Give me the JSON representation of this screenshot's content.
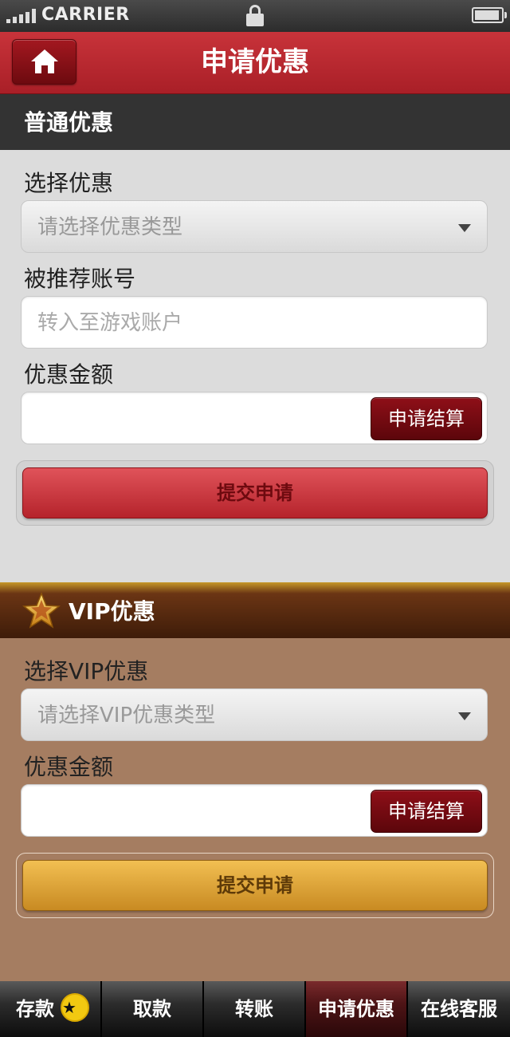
{
  "status_bar": {
    "carrier": "CARRIER",
    "signal_icon": "signal-bars-icon",
    "lock_icon": "lock-icon",
    "battery_icon": "battery-icon",
    "battery_level": 0.85
  },
  "header": {
    "title": "申请优惠",
    "home_icon": "home-icon"
  },
  "normal_section": {
    "title": "普通优惠",
    "select_label": "选择优惠",
    "select_value": "请选择优惠类型",
    "referral_label": "被推荐账号",
    "referral_placeholder": "转入至游戏账户",
    "amount_label": "优惠金额",
    "amount_value": "",
    "calc_button": "申请结算",
    "submit_button": "提交申请"
  },
  "vip_section": {
    "title": "VIP优惠",
    "star_icon": "star-icon",
    "select_label": "选择VIP优惠",
    "select_value": "请选择VIP优惠类型",
    "amount_label": "优惠金额",
    "amount_value": "",
    "calc_button": "申请结算",
    "submit_button": "提交申请"
  },
  "tabbar": {
    "items": [
      {
        "label": "存款",
        "badge": "★"
      },
      {
        "label": "取款"
      },
      {
        "label": "转账"
      },
      {
        "label": "申请优惠",
        "active": true
      },
      {
        "label": "在线客服"
      }
    ]
  },
  "colors": {
    "header_red": "#b3262d",
    "vip_brown": "#a57d61",
    "gold_button": "#e0a73a"
  }
}
